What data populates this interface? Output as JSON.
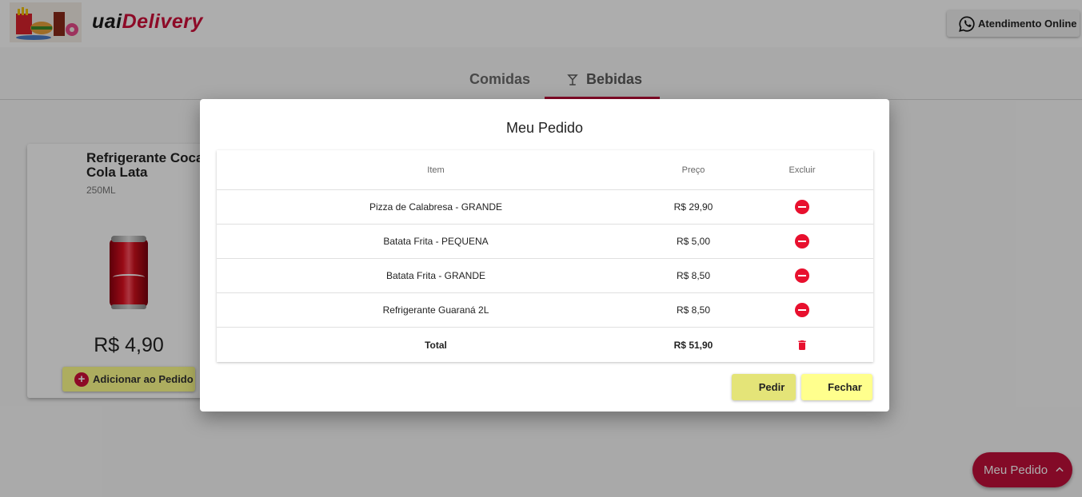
{
  "header": {
    "brand_part1": "uai",
    "brand_part2": "Delivery",
    "support_label": "Atendimento Online",
    "support_icon": "whatsapp-icon"
  },
  "tabs": [
    {
      "label": "Comidas",
      "active": false
    },
    {
      "label": "Bebidas",
      "active": true,
      "icon": "cocktail-glass-icon"
    }
  ],
  "product_card": {
    "title": "Refrigerante Coca Cola Lata",
    "subtitle": "250ML",
    "price": "R$ 4,90",
    "add_button_label": "Adicionar ao Pedido"
  },
  "fab": {
    "label": "Meu Pedido",
    "icon": "chevron-up-icon"
  },
  "order_dialog": {
    "title": "Meu Pedido",
    "columns": {
      "item": "Item",
      "price": "Preço",
      "delete": "Excluir"
    },
    "rows": [
      {
        "item": "Pizza de Calabresa - GRANDE",
        "price": "R$ 29,90"
      },
      {
        "item": "Batata Frita - PEQUENA",
        "price": "R$ 5,00"
      },
      {
        "item": "Batata Frita - GRANDE",
        "price": "R$ 8,50"
      },
      {
        "item": "Refrigerante Guaraná 2L",
        "price": "R$ 8,50"
      }
    ],
    "total_label": "Total",
    "total_value": "R$ 51,90",
    "order_button_label": "Pedir",
    "close_button_label": "Fechar"
  },
  "colors": {
    "brand_red": "#c2103a",
    "delete_red": "#e8102e",
    "button_yellow": "#ffff8d"
  }
}
